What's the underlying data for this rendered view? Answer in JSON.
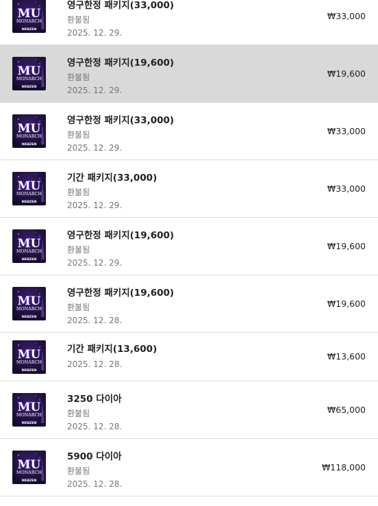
{
  "purchases": [
    {
      "title": "영구한정 패키지(33,000)",
      "status": "환불됨",
      "date": "2025. 12. 29.",
      "price": "₩33,000",
      "selected": false,
      "short": false
    },
    {
      "title": "영구한정 패키지(19,600)",
      "status": "환불됨",
      "date": "2025. 12. 29.",
      "price": "₩19,600",
      "selected": true,
      "short": false
    },
    {
      "title": "영구한정 패키지(33,000)",
      "status": "환불됨",
      "date": "2025. 12. 29.",
      "price": "₩33,000",
      "selected": false,
      "short": false
    },
    {
      "title": "기간 패키지(33,000)",
      "status": "환불됨",
      "date": "2025. 12. 29.",
      "price": "₩33,000",
      "selected": false,
      "short": false
    },
    {
      "title": "영구한정 패키지(19,600)",
      "status": "환불됨",
      "date": "2025. 12. 29.",
      "price": "₩19,600",
      "selected": false,
      "short": false
    },
    {
      "title": "영구한정 패키지(19,600)",
      "status": "환불됨",
      "date": "2025. 12. 28.",
      "price": "₩19,600",
      "selected": false,
      "short": false
    },
    {
      "title": "기간 패키지(13,600)",
      "status": "",
      "date": "2025. 12. 28.",
      "price": "₩13,600",
      "selected": false,
      "short": true
    },
    {
      "title": "3250 다이아",
      "status": "환불됨",
      "date": "2025. 12. 28.",
      "price": "₩65,000",
      "selected": false,
      "short": false
    },
    {
      "title": "5900 다이아",
      "status": "환불됨",
      "date": "2025. 12. 28.",
      "price": "₩118,000",
      "selected": false,
      "short": false
    }
  ],
  "app_icon": {
    "name": "mu-monarch-app-icon",
    "logo_text": "MU",
    "subtitle_text": "MONARCH",
    "publisher_text": "WEBZEN",
    "colors": {
      "bg_dark": "#140a2a",
      "bg_mid": "#3b1f6e",
      "glow": "#b28cff",
      "text": "#ffffff"
    }
  },
  "colors": {
    "selected_row": "#d9d9d9",
    "divider": "#dadce0",
    "primary_text": "#202124",
    "secondary_text": "#70757a"
  }
}
